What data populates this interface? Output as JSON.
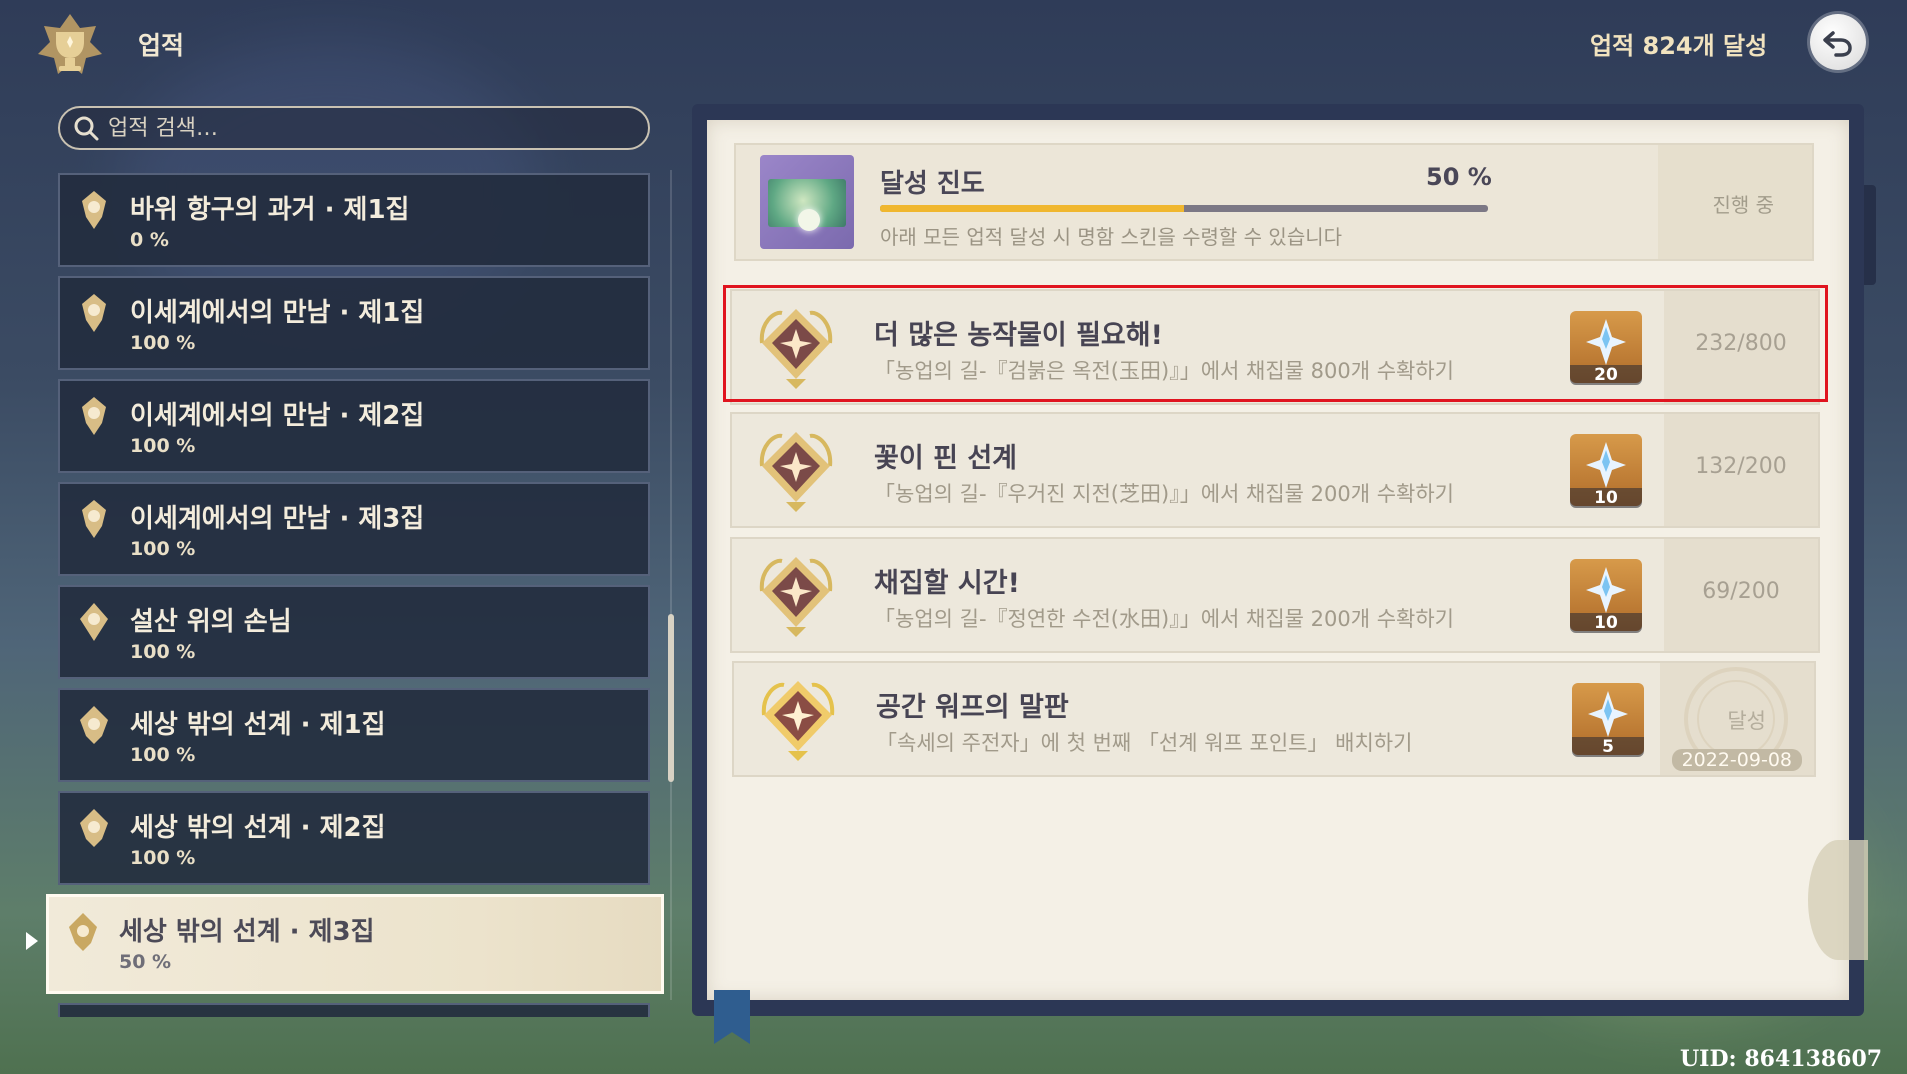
{
  "header": {
    "title": "업적",
    "total_label": "업적 824개 달성"
  },
  "search": {
    "placeholder": "업적 검색…"
  },
  "categories": [
    {
      "title": "바위 항구의 과거 · 제1집",
      "percent": "0 %"
    },
    {
      "title": "이세계에서의 만남 · 제1집",
      "percent": "100 %"
    },
    {
      "title": "이세계에서의 만남 · 제2집",
      "percent": "100 %"
    },
    {
      "title": "이세계에서의 만남 · 제3집",
      "percent": "100 %"
    },
    {
      "title": "설산 위의 손님",
      "percent": "100 %"
    },
    {
      "title": "세상 밖의 선계 · 제1집",
      "percent": "100 %"
    },
    {
      "title": "세상 밖의 선계 · 제2집",
      "percent": "100 %"
    },
    {
      "title": "세상 밖의 선계 · 제3집",
      "percent": "50 %"
    }
  ],
  "progress": {
    "title": "달성 진도",
    "percent_label": "50 %",
    "fill_fraction": 0.5,
    "description": "아래 모든 업적 달성 시 명함 스킨을 수령할 수 있습니다",
    "status": "진행 중"
  },
  "achievements": [
    {
      "title": "더 많은 농작물이 필요해!",
      "description": "「농업의 길-『검붉은 옥전(玉田)』」에서 채집물 800개 수확하기",
      "reward": "20",
      "count": "232/800"
    },
    {
      "title": "꽃이 핀 선계",
      "description": "「농업의 길-『우거진 지전(芝田)』」에서 채집물 200개 수확하기",
      "reward": "10",
      "count": "132/200"
    },
    {
      "title": "채집할 시간!",
      "description": "「농업의 길-『정연한 수전(水田)』」에서 채집물 200개 수확하기",
      "reward": "10",
      "count": "69/200"
    },
    {
      "title": "공간 워프의 말판",
      "description": "「속세의 주전자」에 첫 번째 「선계 워프 포인트」 배치하기",
      "reward": "5",
      "done_label": "달성",
      "done_date": "2022-09-08"
    }
  ],
  "footer": {
    "uid": "UID: 864138607"
  },
  "icons": {
    "header": "achievement-emblem-icon",
    "back": "return-arrow-icon",
    "search": "search-icon",
    "category": "achievement-medal-icon",
    "reward": "primogem-icon"
  },
  "colors": {
    "progress_fill": "#f0b72f",
    "highlight": "#e0141f",
    "reward_bg": "#c57f35"
  }
}
